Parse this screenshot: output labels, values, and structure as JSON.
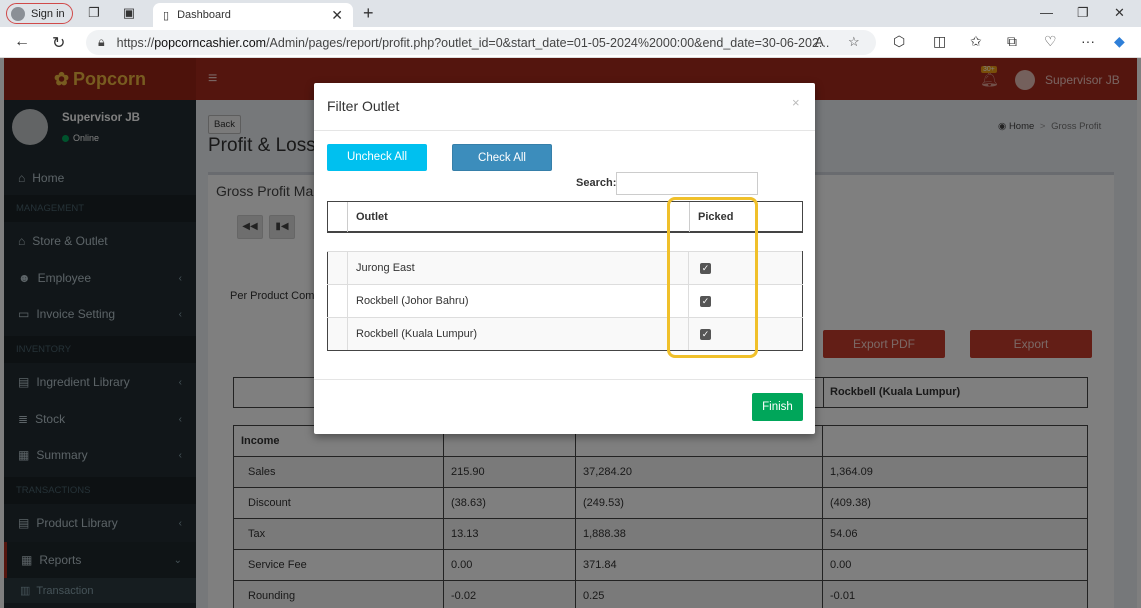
{
  "browser": {
    "signin_label": "Sign in",
    "tab_title": "Dashboard",
    "url_prefix": "https://",
    "url_host": "popcorncashier.com",
    "url_rest": "/Admin/pages/report/profit.php?outlet_id=0&start_date=01-05-2024%2000:00&end_date=30-06-202..."
  },
  "app": {
    "brand": "Popcorn",
    "notif_badge": "30+",
    "user_name": "Supervisor JB"
  },
  "sidebar": {
    "user_name": "Supervisor JB",
    "user_status": "Online",
    "home": "Home",
    "section_management": "MANAGEMENT",
    "store_outlet": "Store & Outlet",
    "employee": "Employee",
    "invoice_setting": "Invoice Setting",
    "section_inventory": "INVENTORY",
    "ingredient_library": "Ingredient Library",
    "stock": "Stock",
    "summary": "Summary",
    "section_transactions": "TRANSACTIONS",
    "product_library": "Product Library",
    "reports": "Reports",
    "transaction": "Transaction"
  },
  "content": {
    "back_label": "Back",
    "page_title": "Profit & Loss",
    "breadcrumb_home": "Home",
    "breadcrumb_current": "Gross Profit",
    "box_title": "Gross Profit Mar",
    "per_product": "Per Product Comp",
    "export_pdf": "Export PDF",
    "export": "Export",
    "col4_header": "Rockbell (Kuala Lumpur)"
  },
  "report": {
    "section_income": "Income",
    "rows": [
      {
        "label": "Sales",
        "v1": "215.90",
        "v2": "37,284.20",
        "v3": "1,364.09"
      },
      {
        "label": "Discount",
        "v1": "(38.63)",
        "v2": "(249.53)",
        "v3": "(409.38)"
      },
      {
        "label": "Tax",
        "v1": "13.13",
        "v2": "1,888.38",
        "v3": "54.06"
      },
      {
        "label": "Service Fee",
        "v1": "0.00",
        "v2": "371.84",
        "v3": "0.00"
      },
      {
        "label": "Rounding",
        "v1": "-0.02",
        "v2": "0.25",
        "v3": "-0.01"
      }
    ]
  },
  "modal": {
    "title": "Filter Outlet",
    "close": "×",
    "uncheck_all": "Uncheck All",
    "check_all": "Check All",
    "search_label": "Search:",
    "search_value": "",
    "col_outlet": "Outlet",
    "col_picked": "Picked",
    "outlets": [
      {
        "name": "Jurong East",
        "picked": true
      },
      {
        "name": "Rockbell (Johor Bahru)",
        "picked": true
      },
      {
        "name": "Rockbell (Kuala Lumpur)",
        "picked": true
      }
    ],
    "finish": "Finish"
  }
}
